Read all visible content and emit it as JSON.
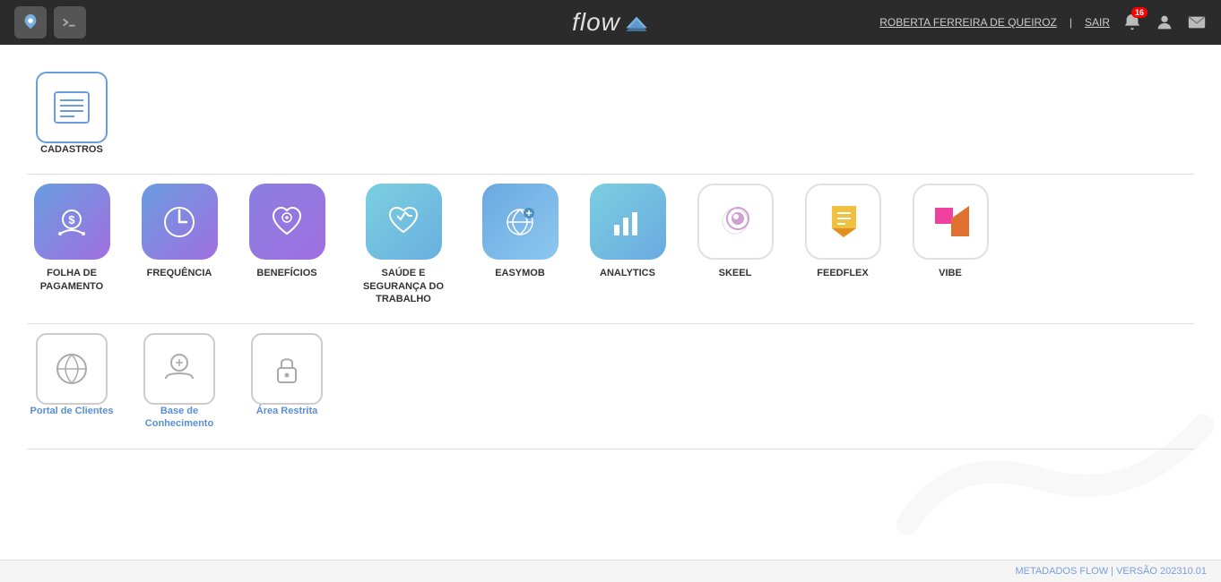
{
  "header": {
    "logo_text": "flow",
    "user_name": "ROBERTA FERREIRA DE QUEIROZ",
    "separator": "|",
    "sair_label": "SAIR",
    "notif_count": "16"
  },
  "sections": [
    {
      "id": "cadastros",
      "apps": [
        {
          "id": "cadastros",
          "label": "CADASTROS",
          "icon_type": "cadastros"
        }
      ]
    },
    {
      "id": "main-apps",
      "apps": [
        {
          "id": "folha",
          "label": "FOLHA DE PAGAMENTO",
          "icon_type": "folha"
        },
        {
          "id": "frequencia",
          "label": "FREQUÊNCIA",
          "icon_type": "frequencia"
        },
        {
          "id": "beneficios",
          "label": "BENEFÍCIOS",
          "icon_type": "beneficios"
        },
        {
          "id": "saude",
          "label": "SAÚDE E SEGURANÇA DO TRABALHO",
          "icon_type": "saude"
        },
        {
          "id": "easymob",
          "label": "EASYMOB",
          "icon_type": "easymob"
        },
        {
          "id": "analytics",
          "label": "ANALYTICS",
          "icon_type": "analytics"
        },
        {
          "id": "skeel",
          "label": "SKEEL",
          "icon_type": "skeel"
        },
        {
          "id": "feedflex",
          "label": "FEEDFLEX",
          "icon_type": "feedflex"
        },
        {
          "id": "vibe",
          "label": "VIBE",
          "icon_type": "vibe"
        }
      ]
    },
    {
      "id": "portal-apps",
      "apps": [
        {
          "id": "portal",
          "label": "Portal de Clientes",
          "icon_type": "portal"
        },
        {
          "id": "base",
          "label": "Base de Conhecimento",
          "icon_type": "base"
        },
        {
          "id": "restrita",
          "label": "Área Restrita",
          "icon_type": "restrita"
        }
      ]
    }
  ],
  "footer": {
    "text": "METADADOS FLOW | VERSÃO 202310.01"
  }
}
